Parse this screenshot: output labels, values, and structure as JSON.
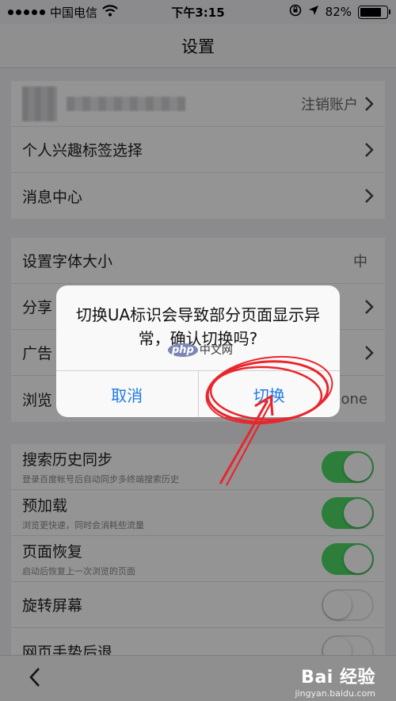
{
  "status_bar": {
    "carrier": "中国电信",
    "time": "下午3:15",
    "battery_percent": "82%",
    "battery_level": 0.82
  },
  "nav": {
    "title": "设置"
  },
  "groups": {
    "account": {
      "logout_label": "注销账户",
      "rows": [
        {
          "label": "个人兴趣标签选择"
        },
        {
          "label": "消息中心"
        }
      ]
    },
    "display": {
      "font_size_label": "设置字体大小",
      "font_size_value": "中",
      "share_label": "分享",
      "ad_label": "广告",
      "browser_label": "浏览",
      "browser_value": "none"
    },
    "toggles": [
      {
        "label": "搜索历史同步",
        "sub": "登录百度帐号后自动同步多终端搜索历史",
        "on": true
      },
      {
        "label": "预加载",
        "sub": "浏览更快速，同时会消耗些流量",
        "on": true
      },
      {
        "label": "页面恢复",
        "sub": "启动后恢复上一次浏览的页面",
        "on": true
      },
      {
        "label": "旋转屏幕",
        "sub": "",
        "on": false
      },
      {
        "label": "网页手势后退",
        "sub": "",
        "on": false
      }
    ]
  },
  "dialog": {
    "message": "切换UA标识会导致部分页面显示异常，确认切换吗?",
    "cancel_label": "取消",
    "confirm_label": "切换"
  },
  "watermark": {
    "logo": "Bai 经验",
    "url": "jingyan.baidu.com",
    "php_badge": "php",
    "php_text": "中文网"
  },
  "colors": {
    "toggle_on": "#4cd964",
    "ios_blue": "#1f7ae6",
    "annotation_red": "#e8262c"
  }
}
